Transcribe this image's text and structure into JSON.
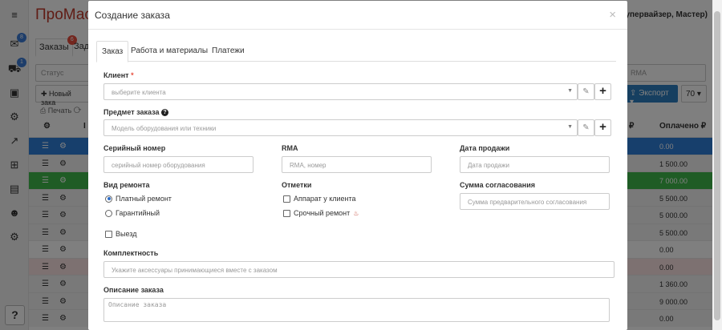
{
  "background": {
    "brand": "ПроМаст",
    "role": "Супервайзер, Мастер)",
    "sidebar_badges": [
      "8",
      "1"
    ],
    "tabs": [
      {
        "label": "Заказы",
        "badge": "6"
      },
      {
        "label": "Зад"
      }
    ],
    "filter_status_placeholder": "Статус",
    "filter_rma_placeholder": "RMA",
    "new_button": "Новый зака",
    "export_button": "Экспорт",
    "per_page": "70",
    "print": "Печать",
    "columns": {
      "id": "I",
      "sum": "₽",
      "paid": "Оплачено ₽"
    },
    "rows": [
      {
        "paid": "0.00",
        "color": "#2f7ed8"
      },
      {
        "paid": "1 500.00",
        "color": "#f2f2f2"
      },
      {
        "paid": "7 000.00",
        "color": "#3fb94a"
      },
      {
        "paid": "5 500.00",
        "color": "#f2f2f2"
      },
      {
        "paid": "5 000.00",
        "color": "#f2f2f2"
      },
      {
        "paid": "5 500.00",
        "color": "#f2f2f2"
      },
      {
        "paid": "0.00",
        "color": "#ffffff"
      },
      {
        "paid": "0.00",
        "color": "#fbe3e3"
      },
      {
        "paid": "1 360.00",
        "color": "#f2f2f2"
      },
      {
        "paid": "9 000.00",
        "color": "#f2f2f2"
      },
      {
        "paid": "0.00",
        "color": "#f2f2f2"
      }
    ]
  },
  "modal": {
    "title": "Создание заказа",
    "close": "×",
    "tabs": [
      "Заказ",
      "Работа и материалы",
      "Платежи"
    ],
    "client": {
      "label": "Клиент",
      "required": "*",
      "placeholder": "выберите клиента"
    },
    "subject": {
      "label": "Предмет заказа",
      "placeholder": "Модель оборудования или техники"
    },
    "serial": {
      "label": "Серийный номер",
      "placeholder": "серийный номер оборудования"
    },
    "rma": {
      "label": "RMA",
      "placeholder": "RMA, номер"
    },
    "sale_date": {
      "label": "Дата продажи",
      "placeholder": "Дата продажи"
    },
    "repair_type": {
      "label": "Вид ремонта",
      "options": [
        "Платный ремонт",
        "Гарантийный"
      ],
      "selected": 0
    },
    "marks": {
      "label": "Отметки",
      "options": [
        "Аппарат у клиента",
        "Срочный ремонт"
      ]
    },
    "approval_sum": {
      "label": "Сумма согласования",
      "placeholder": "Сумма предварительного согласования"
    },
    "visit": {
      "label": "Выезд"
    },
    "kit": {
      "label": "Комплектность",
      "placeholder": "Укажите аксессуары принимающиеся вместе с заказом"
    },
    "description": {
      "label": "Описание заказа",
      "placeholder": "Описание заказа"
    }
  }
}
